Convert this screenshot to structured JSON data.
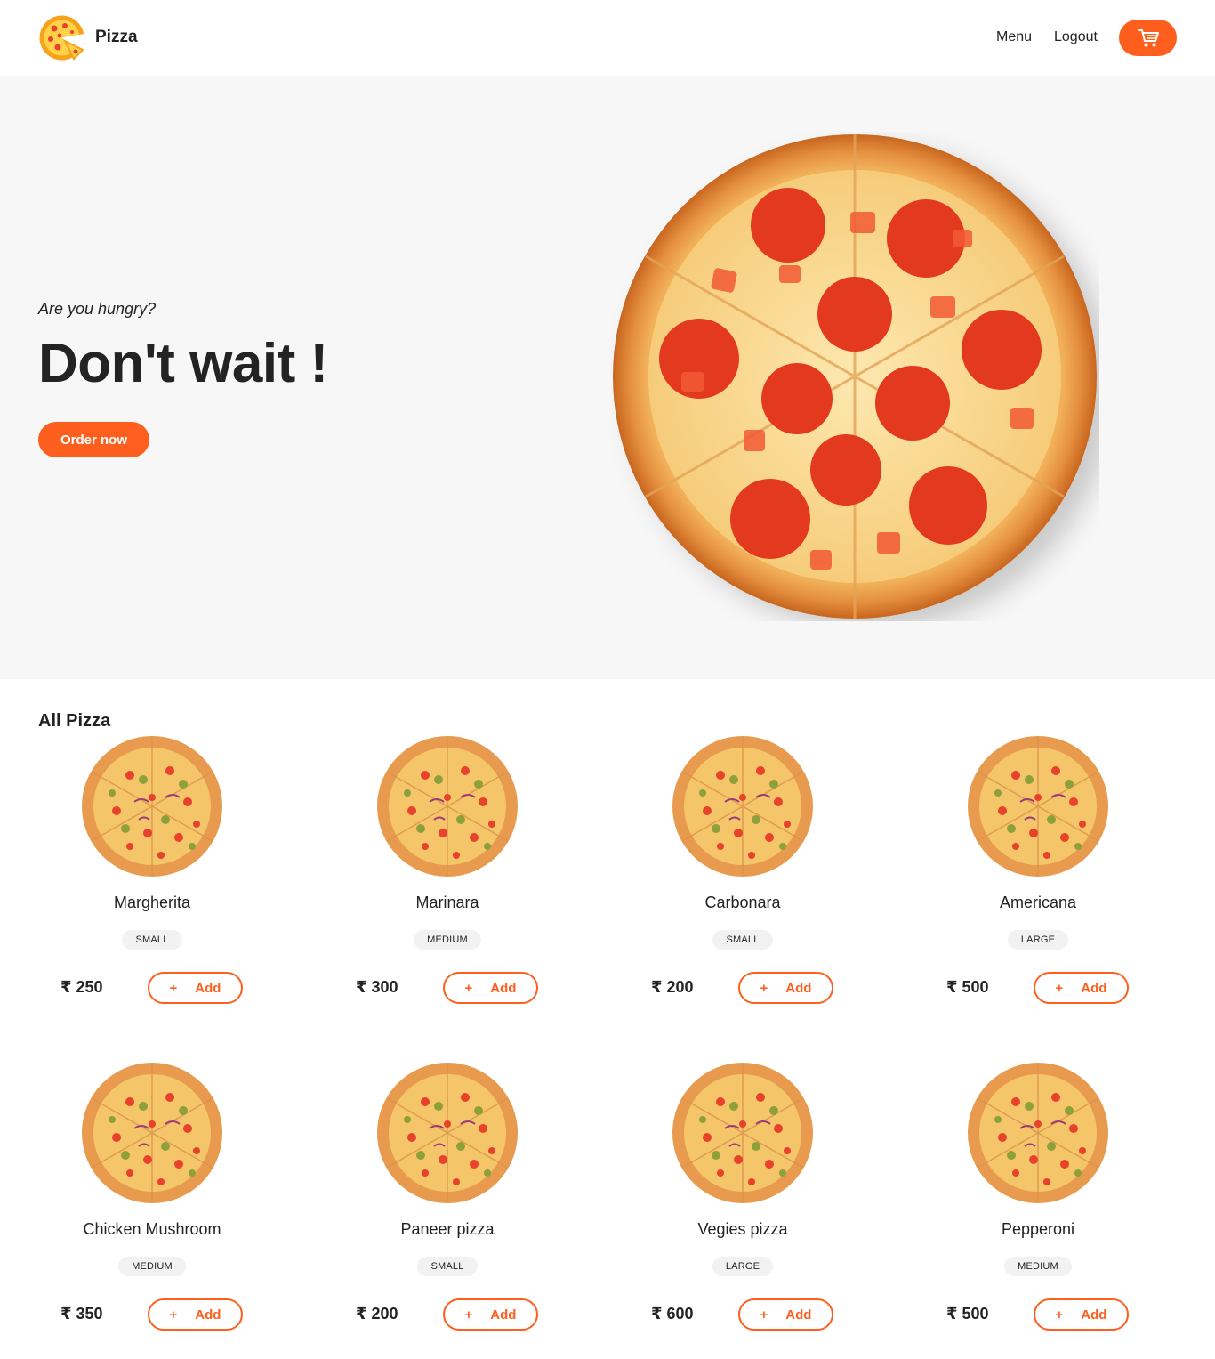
{
  "brand": {
    "name": "Pizza",
    "logo_icon": "pizza-logo-icon"
  },
  "nav": {
    "menu": "Menu",
    "logout": "Logout",
    "cart_icon": "cart-icon"
  },
  "hero": {
    "subtitle": "Are you hungry?",
    "title": "Don't wait !",
    "cta": "Order now"
  },
  "colors": {
    "accent": "#fe5f1e",
    "hero_bg": "#f7f7f7",
    "text": "#232323",
    "badge_bg": "#f2f2f2"
  },
  "menu": {
    "title": "All Pizza",
    "currency": "₹",
    "add_plus": "+",
    "add_label": "Add",
    "items": [
      {
        "name": "Margherita",
        "size": "SMALL",
        "price": "₹ 250"
      },
      {
        "name": "Marinara",
        "size": "MEDIUM",
        "price": "₹ 300"
      },
      {
        "name": "Carbonara",
        "size": "SMALL",
        "price": "₹ 200"
      },
      {
        "name": "Americana",
        "size": "LARGE",
        "price": "₹ 500"
      },
      {
        "name": "Chicken Mushroom",
        "size": "MEDIUM",
        "price": "₹ 350"
      },
      {
        "name": "Paneer pizza",
        "size": "SMALL",
        "price": "₹ 200"
      },
      {
        "name": "Vegies pizza",
        "size": "LARGE",
        "price": "₹ 600"
      },
      {
        "name": "Pepperoni",
        "size": "MEDIUM",
        "price": "₹ 500"
      }
    ]
  }
}
